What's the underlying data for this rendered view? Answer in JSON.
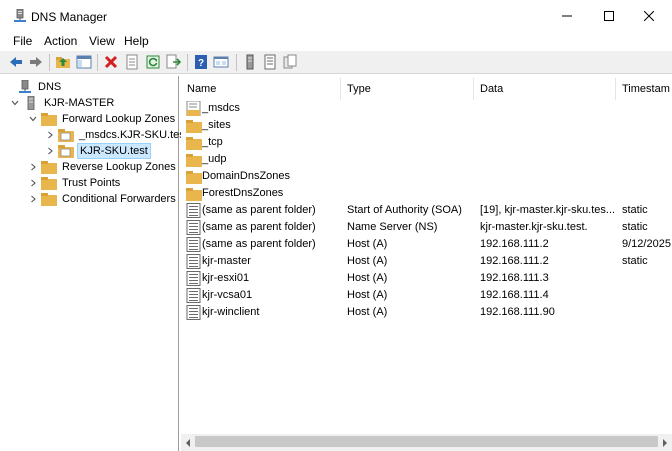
{
  "window": {
    "title": "DNS Manager",
    "minimize_icon": "minimize-icon",
    "maximize_icon": "maximize-icon",
    "close_icon": "close-icon"
  },
  "menu": [
    "File",
    "Action",
    "View",
    "Help"
  ],
  "toolbar_icons": [
    "back-icon",
    "forward-icon",
    "up-folder-icon",
    "show-hide-tree-icon",
    "delete-icon",
    "properties-icon",
    "refresh-icon",
    "export-list-icon",
    "help-icon",
    "view-icon",
    "server-icon",
    "zone-records-icon",
    "copy-icon"
  ],
  "tree": {
    "root": "DNS",
    "server": "KJR-MASTER",
    "forward_zones": "Forward Lookup Zones",
    "zone_msdcs": "_msdcs.KJR-SKU.test",
    "zone_selected": "KJR-SKU.test",
    "reverse_zones": "Reverse Lookup Zones",
    "trust_points": "Trust Points",
    "conditional_forwarders": "Conditional Forwarders"
  },
  "columns": {
    "name": "Name",
    "type": "Type",
    "data": "Data",
    "timestamp": "Timestam"
  },
  "rows": [
    {
      "icon": "zone-icon",
      "name": "_msdcs",
      "type": "",
      "data": "",
      "timestamp": ""
    },
    {
      "icon": "folder-icon",
      "name": "_sites",
      "type": "",
      "data": "",
      "timestamp": ""
    },
    {
      "icon": "folder-icon",
      "name": "_tcp",
      "type": "",
      "data": "",
      "timestamp": ""
    },
    {
      "icon": "folder-icon",
      "name": "_udp",
      "type": "",
      "data": "",
      "timestamp": ""
    },
    {
      "icon": "folder-icon",
      "name": "DomainDnsZones",
      "type": "",
      "data": "",
      "timestamp": ""
    },
    {
      "icon": "folder-icon",
      "name": "ForestDnsZones",
      "type": "",
      "data": "",
      "timestamp": ""
    },
    {
      "icon": "record-icon",
      "name": "(same as parent folder)",
      "type": "Start of Authority (SOA)",
      "data": "[19], kjr-master.kjr-sku.tes...",
      "timestamp": "static"
    },
    {
      "icon": "record-icon",
      "name": "(same as parent folder)",
      "type": "Name Server (NS)",
      "data": "kjr-master.kjr-sku.test.",
      "timestamp": "static"
    },
    {
      "icon": "record-icon",
      "name": "(same as parent folder)",
      "type": "Host (A)",
      "data": "192.168.111.2",
      "timestamp": "9/12/2025"
    },
    {
      "icon": "record-icon",
      "name": "kjr-master",
      "type": "Host (A)",
      "data": "192.168.111.2",
      "timestamp": "static"
    },
    {
      "icon": "record-icon",
      "name": "kjr-esxi01",
      "type": "Host (A)",
      "data": "192.168.111.3",
      "timestamp": ""
    },
    {
      "icon": "record-icon",
      "name": "kjr-vcsa01",
      "type": "Host (A)",
      "data": "192.168.111.4",
      "timestamp": ""
    },
    {
      "icon": "record-icon",
      "name": "kjr-winclient",
      "type": "Host (A)",
      "data": "192.168.111.90",
      "timestamp": ""
    }
  ],
  "colors": {
    "selection": "#cce8ff",
    "selection_border": "#99d1ff",
    "folder": "#e8b64c",
    "toolbar_bg": "#f0f0f0"
  }
}
